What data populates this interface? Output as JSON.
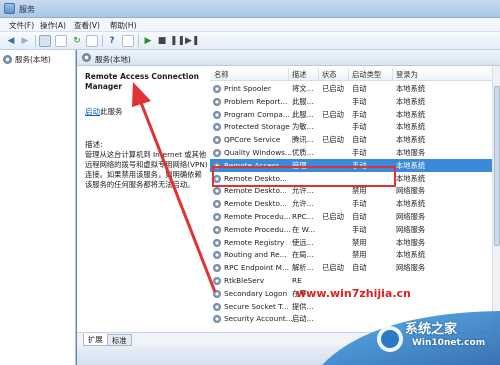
{
  "window": {
    "title": "服务"
  },
  "menu": [
    "文件(F)",
    "操作(A)",
    "查看(V)",
    "帮助(H)"
  ],
  "tree": {
    "root_label": "服务(本地)"
  },
  "header": {
    "label": "服务(本地)"
  },
  "details": {
    "service_title": "Remote Access Connection Manager",
    "start_link": "启动",
    "start_suffix": "此服务",
    "desc_label": "描述:",
    "desc_text": "管理从这台计算机到 Internet 或其他远程网络的拨号和虚拟专用网络(VPN)连接。如果禁用该服务，则明确依赖该服务的任何服务都将无法启动。"
  },
  "columns": [
    "名称",
    "描述",
    "状态",
    "启动类型",
    "登录为"
  ],
  "rows": [
    {
      "name": "Print Spooler",
      "desc": "将文...",
      "status": "已启动",
      "startup": "自动",
      "logon": "本地系统"
    },
    {
      "name": "Problem Report...",
      "desc": "此服...",
      "status": "",
      "startup": "手动",
      "logon": "本地系统"
    },
    {
      "name": "Program Compa...",
      "desc": "此服...",
      "status": "已启动",
      "startup": "手动",
      "logon": "本地系统"
    },
    {
      "name": "Protected Storage",
      "desc": "为敏...",
      "status": "",
      "startup": "手动",
      "logon": "本地系统"
    },
    {
      "name": "QPCore Service",
      "desc": "腾讯...",
      "status": "已启动",
      "startup": "自动",
      "logon": "本地系统"
    },
    {
      "name": "Quality Windows...",
      "desc": "优质...",
      "status": "",
      "startup": "手动",
      "logon": "本地服务"
    },
    {
      "name": "Remote Access ...",
      "desc": "管理...",
      "status": "",
      "startup": "手动",
      "logon": "本地系统"
    },
    {
      "name": "Remote Deskto...",
      "desc": "",
      "status": "",
      "startup": "",
      "logon": "本地系统"
    },
    {
      "name": "Remote Deskto...",
      "desc": "允许...",
      "status": "",
      "startup": "禁用",
      "logon": "网络服务"
    },
    {
      "name": "Remote Deskto...",
      "desc": "允许...",
      "status": "",
      "startup": "手动",
      "logon": "本地系统"
    },
    {
      "name": "Remote Procedu...",
      "desc": "RPC...",
      "status": "已启动",
      "startup": "自动",
      "logon": "网络服务"
    },
    {
      "name": "Remote Procedu...",
      "desc": "在 W...",
      "status": "",
      "startup": "手动",
      "logon": "网络服务"
    },
    {
      "name": "Remote Registry",
      "desc": "使远...",
      "status": "",
      "startup": "禁用",
      "logon": "本地服务"
    },
    {
      "name": "Routing and Re...",
      "desc": "在局...",
      "status": "",
      "startup": "禁用",
      "logon": "本地系统"
    },
    {
      "name": "RPC Endpoint M...",
      "desc": "解析...",
      "status": "已启动",
      "startup": "自动",
      "logon": "网络服务"
    },
    {
      "name": "RtkBleServ",
      "desc": "RE",
      "status": "",
      "startup": "",
      "logon": ""
    },
    {
      "name": "Secondary Logon",
      "desc": "在不...",
      "status": "",
      "startup": "",
      "logon": ""
    },
    {
      "name": "Secure Socket T...",
      "desc": "提供...",
      "status": "",
      "startup": "",
      "logon": ""
    },
    {
      "name": "Security Account...",
      "desc": "启动...",
      "status": "",
      "startup": "",
      "logon": ""
    }
  ],
  "tabs": [
    "扩展",
    "标准"
  ],
  "watermark": {
    "url": "www.win7zhijia.cn",
    "brand": "系统之家",
    "site": "Win10net.com"
  },
  "colors": {
    "highlight": "#e03233",
    "selection": "#3b8ad9",
    "link": "#0066cc"
  }
}
